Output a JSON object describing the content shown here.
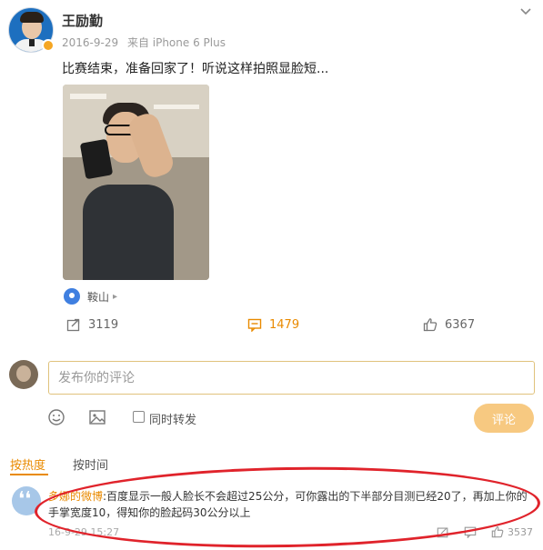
{
  "post": {
    "username": "王励勤",
    "date": "2016-9-29",
    "source": "来自 iPhone 6 Plus",
    "text": "比赛结束，准备回家了！听说这样拍照显脸短...",
    "location": "鞍山",
    "location_arrow": "▸"
  },
  "actions": {
    "repost_count": "3119",
    "comment_count": "1479",
    "like_count": "6367"
  },
  "comment_box": {
    "placeholder": "发布你的评论",
    "repost_option": "同时转发",
    "submit_label": "评论"
  },
  "sort_tabs": {
    "hot": "按热度",
    "time": "按时间"
  },
  "top_comment": {
    "author": "多娜的微博",
    "text": ":百度显示一般人脸长不会超过25公分，可你露出的下半部分目测已经20了，再加上你的手掌宽度10，得知你的脸起码30公分以上",
    "time": "16-9-29 15:27",
    "like_count": "3537"
  },
  "colors": {
    "accent": "#e98a00",
    "annotation": "#e0232b"
  }
}
